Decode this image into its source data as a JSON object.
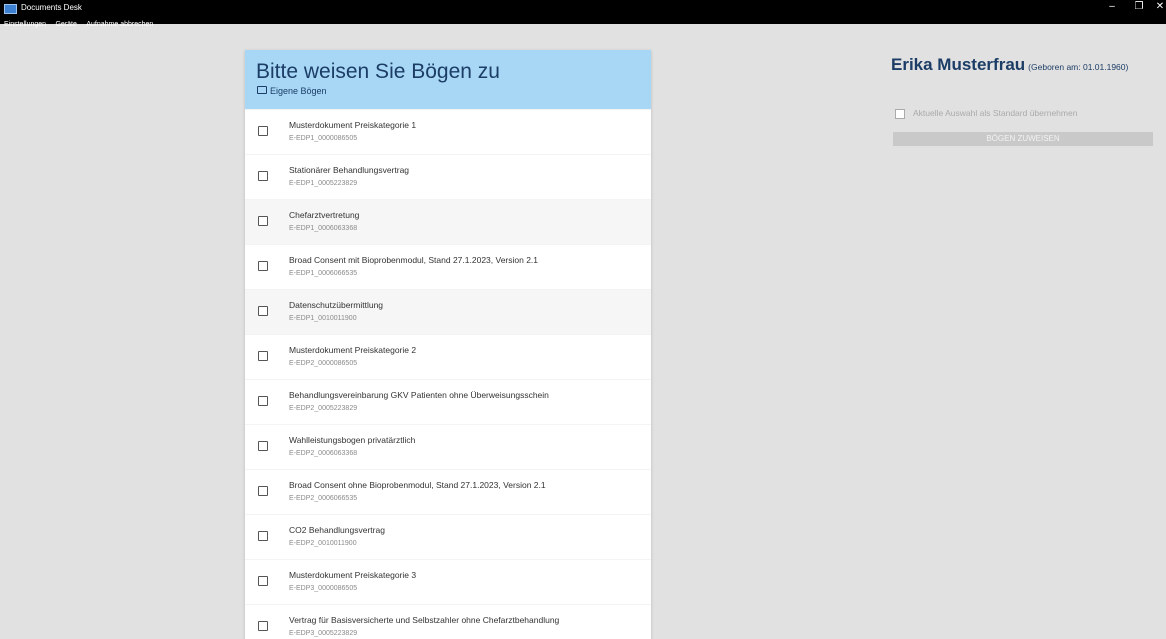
{
  "window": {
    "title": "Documents Desk",
    "controls": {
      "minimize": "–",
      "maximize": "❐",
      "close": "✕"
    }
  },
  "menu": [
    "Einstellungen",
    "Geräte",
    "Aufnahme abbrechen"
  ],
  "panel": {
    "title": "Bitte weisen Sie Bögen zu",
    "folder_link": "Eigene Bögen",
    "documents": [
      {
        "title": "Musterdokument Preiskategorie 1",
        "code": "E-EDP1_0000086505"
      },
      {
        "title": "Stationärer Behandlungsvertrag",
        "code": "E-EDP1_0005223829"
      },
      {
        "title": "Chefarztvertretung",
        "code": "E-EDP1_0006063368"
      },
      {
        "title": "Broad Consent mit Bioprobenmodul, Stand 27.1.2023, Version 2.1",
        "code": "E-EDP1_0006066535"
      },
      {
        "title": "Datenschutzübermittlung",
        "code": "E-EDP1_0010011900"
      },
      {
        "title": "Musterdokument Preiskategorie 2",
        "code": "E-EDP2_0000086505"
      },
      {
        "title": "Behandlungsvereinbarung GKV Patienten ohne Überweisungsschein",
        "code": "E-EDP2_0005223829"
      },
      {
        "title": "Wahlleistungsbogen privatärztlich",
        "code": "E-EDP2_0006063368"
      },
      {
        "title": "Broad Consent ohne Bioprobenmodul, Stand 27.1.2023, Version 2.1",
        "code": "E-EDP2_0006066535"
      },
      {
        "title": "CO2 Behandlungsvertrag",
        "code": "E-EDP2_0010011900"
      },
      {
        "title": "Musterdokument Preiskategorie 3",
        "code": "E-EDP3_0000086505"
      },
      {
        "title": "Vertrag für Basisversicherte und Selbstzahler ohne Chefarztbehandlung",
        "code": "E-EDP3_0005223829"
      }
    ]
  },
  "patient": {
    "name": "Erika Musterfrau",
    "birth": "(Geboren am: 01.01.1960)"
  },
  "options": {
    "standard_label": "Aktuelle Auswahl als Standard übernehmen",
    "assign_button": "BÖGEN ZUWEISEN"
  },
  "colors": {
    "header_bg": "#a7d7f5",
    "accent": "#1c3d66",
    "page_bg": "#e1e1e1"
  }
}
